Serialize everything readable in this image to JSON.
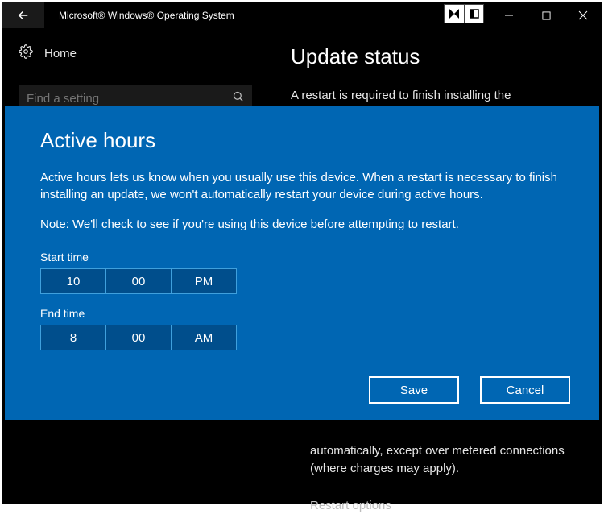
{
  "titlebar": {
    "title": "Microsoft® Windows® Operating System"
  },
  "sidebar": {
    "home": "Home",
    "search_placeholder": "Find a setting"
  },
  "main": {
    "heading": "Update status",
    "line1": "A restart is required to finish installing the",
    "bottom_text": "automatically, except over metered connections (where charges may apply).",
    "restart_options": "Restart options"
  },
  "dialog": {
    "title": "Active hours",
    "desc": "Active hours lets us know when you usually use this device. When a restart is necessary to finish installing an update, we won't automatically restart your device during active hours.",
    "note": "Note: We'll check to see if you're using this device before attempting to restart.",
    "start_label": "Start time",
    "start": {
      "hour": "10",
      "minute": "00",
      "ampm": "PM"
    },
    "end_label": "End time",
    "end": {
      "hour": "8",
      "minute": "00",
      "ampm": "AM"
    },
    "save": "Save",
    "cancel": "Cancel"
  }
}
